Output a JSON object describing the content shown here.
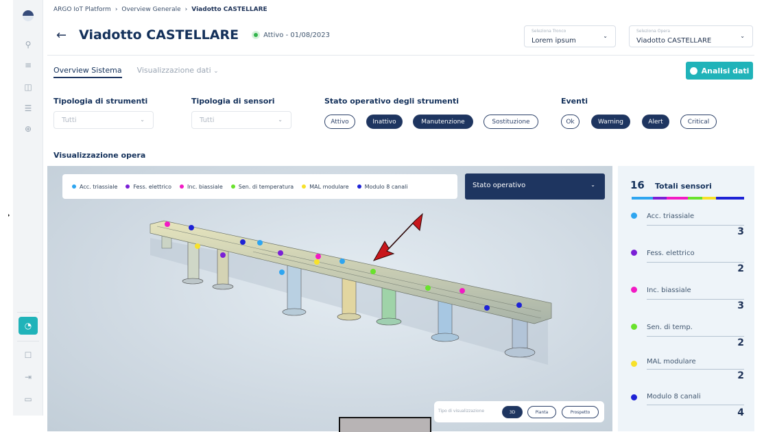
{
  "breadcrumb": [
    "ARGO IoT Platform",
    "Overview Generale",
    "Viadotto CASTELLARE"
  ],
  "header": {
    "back": "←",
    "title": "Viadotto CASTELLARE",
    "status": "Attivo - 01/08/2023"
  },
  "selectors": [
    {
      "label": "Seleziona Tronco",
      "value": "Lorem ipsum"
    },
    {
      "label": "Seleziona Opera",
      "value": "Viadotto CASTELLARE"
    }
  ],
  "tabs": {
    "overview": "Overview Sistema",
    "dati": "Visualizzazione dati"
  },
  "analisi_button": "Analisi dati",
  "filters": {
    "strumenti": {
      "label": "Tipologia di strumenti",
      "value": "Tutti"
    },
    "sensori": {
      "label": "Tipologia di sensori",
      "value": "Tutti"
    },
    "stato": {
      "label": "Stato operativo degli strumenti",
      "options": [
        "Attivo",
        "Inattivo",
        "Manutenzione",
        "Sostituzione"
      ]
    },
    "eventi": {
      "label": "Eventi",
      "options": [
        "Ok",
        "Warning",
        "Alert",
        "Critical"
      ]
    }
  },
  "viz_title": "Visualizzazione opera",
  "legend": [
    {
      "label": "Acc. triassiale",
      "color": "#2ea5f0"
    },
    {
      "label": "Fess. elettrico",
      "color": "#7a1fd6"
    },
    {
      "label": "Inc. biassiale",
      "color": "#f21ac4"
    },
    {
      "label": "Sen. di temperatura",
      "color": "#69e22c"
    },
    {
      "label": "MAL modulare",
      "color": "#f7e12a"
    },
    {
      "label": "Modulo 8 canali",
      "color": "#1d22d6"
    }
  ],
  "stato_select": "Stato operativo",
  "vis_type": {
    "label": "Tipo di visualizzazione",
    "options": [
      "3D",
      "Pianta",
      "Prospetto"
    ]
  },
  "panel": {
    "total": "16",
    "total_label": "Totali sensori",
    "items": [
      {
        "name": "Acc. triassiale",
        "count": "3",
        "color": "#2ea5f0"
      },
      {
        "name": "Fess. elettrico",
        "count": "2",
        "color": "#7a1fd6"
      },
      {
        "name": "Inc. biassiale",
        "count": "3",
        "color": "#f21ac4"
      },
      {
        "name": "Sen. di temp.",
        "count": "2",
        "color": "#69e22c"
      },
      {
        "name": "MAL modulare",
        "count": "2",
        "color": "#f7e12a"
      },
      {
        "name": "Modulo 8 canali",
        "count": "4",
        "color": "#1d22d6"
      }
    ]
  }
}
